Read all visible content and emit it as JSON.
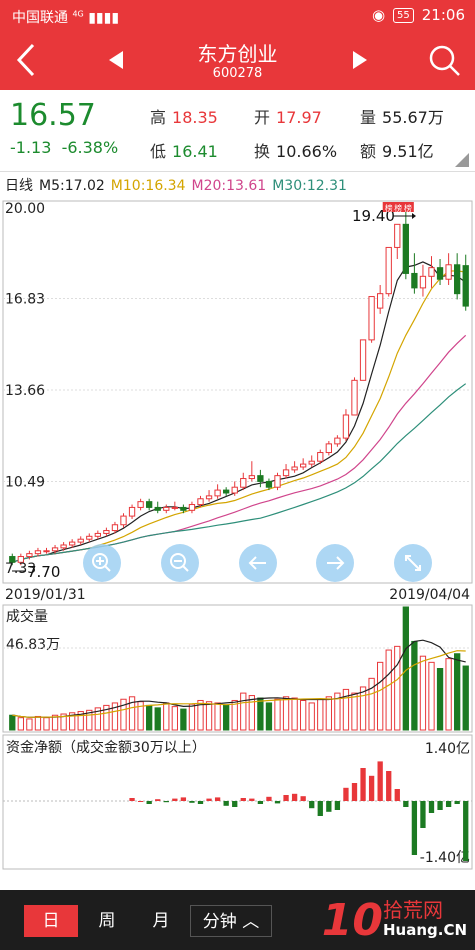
{
  "status": {
    "carrier": "中国联通",
    "net": "4G",
    "battery": "55",
    "time": "21:06"
  },
  "header": {
    "title": "东方创业",
    "code": "600278"
  },
  "quote": {
    "price": "16.57",
    "change": "-1.13",
    "change_pct": "-6.38%",
    "high_label": "高",
    "high": "18.35",
    "open_label": "开",
    "open": "17.97",
    "vol_label": "量",
    "vol": "55.67万",
    "low_label": "低",
    "low": "16.41",
    "turnover_label": "换",
    "turnover": "10.66%",
    "amount_label": "额",
    "amount": "9.51亿"
  },
  "ma": {
    "period": "日线",
    "m5": "M5:17.02",
    "m10": "M10:16.34",
    "m20": "M20:13.61",
    "m30": "M30:12.31"
  },
  "colors": {
    "up": "#e8373a",
    "down": "#1c7a22",
    "m5": "#222222",
    "m10": "#d4a500",
    "m20": "#d0458c",
    "m30": "#2e8f7a",
    "nav": "#e8373a"
  },
  "chart_data": {
    "type": "candlestick",
    "y_ticks": [
      "20.00",
      "16.83",
      "13.66",
      "10.49",
      "7.33"
    ],
    "ylim": [
      7.33,
      20.0
    ],
    "max_label": "19.40",
    "min_label": "7.70",
    "limit_up_badge": "榜",
    "date_start": "2019/01/31",
    "date_end": "2019/04/04",
    "volume_title": "成交量",
    "volume_tick": "46.83万",
    "capital_title": "资金净额（成交金额30万以上）",
    "capital_max": "1.40亿",
    "capital_min": "-1.40亿",
    "candles": [
      [
        7.9,
        7.7,
        8.0,
        7.6
      ],
      [
        7.7,
        7.9,
        8.0,
        7.6
      ],
      [
        7.9,
        8.0,
        8.1,
        7.8
      ],
      [
        8.0,
        8.1,
        8.2,
        7.9
      ],
      [
        8.1,
        8.1,
        8.2,
        8.0
      ],
      [
        8.1,
        8.2,
        8.3,
        8.0
      ],
      [
        8.2,
        8.3,
        8.4,
        8.1
      ],
      [
        8.3,
        8.4,
        8.5,
        8.2
      ],
      [
        8.4,
        8.5,
        8.6,
        8.3
      ],
      [
        8.5,
        8.6,
        8.7,
        8.4
      ],
      [
        8.6,
        8.7,
        8.8,
        8.5
      ],
      [
        8.7,
        8.8,
        8.9,
        8.6
      ],
      [
        8.8,
        9.0,
        9.1,
        8.7
      ],
      [
        9.0,
        9.3,
        9.4,
        8.9
      ],
      [
        9.3,
        9.6,
        9.7,
        9.2
      ],
      [
        9.6,
        9.8,
        9.9,
        9.5
      ],
      [
        9.8,
        9.6,
        9.9,
        9.5
      ],
      [
        9.6,
        9.5,
        9.8,
        9.4
      ],
      [
        9.5,
        9.6,
        9.7,
        9.4
      ],
      [
        9.6,
        9.6,
        9.8,
        9.5
      ],
      [
        9.6,
        9.5,
        9.7,
        9.4
      ],
      [
        9.5,
        9.7,
        9.8,
        9.4
      ],
      [
        9.7,
        9.9,
        10.0,
        9.6
      ],
      [
        9.9,
        10.0,
        10.2,
        9.8
      ],
      [
        10.0,
        10.2,
        10.4,
        9.9
      ],
      [
        10.2,
        10.1,
        10.3,
        10.0
      ],
      [
        10.1,
        10.3,
        10.5,
        10.0
      ],
      [
        10.3,
        10.6,
        10.8,
        10.2
      ],
      [
        10.6,
        10.7,
        11.2,
        10.5
      ],
      [
        10.7,
        10.5,
        10.9,
        10.3
      ],
      [
        10.5,
        10.3,
        10.6,
        10.2
      ],
      [
        10.3,
        10.7,
        10.8,
        10.2
      ],
      [
        10.7,
        10.9,
        11.1,
        10.6
      ],
      [
        10.9,
        11.0,
        11.2,
        10.8
      ],
      [
        11.0,
        11.1,
        11.3,
        10.9
      ],
      [
        11.1,
        11.2,
        11.4,
        11.0
      ],
      [
        11.2,
        11.5,
        11.6,
        11.1
      ],
      [
        11.5,
        11.8,
        11.9,
        11.4
      ],
      [
        11.8,
        12.0,
        12.1,
        11.7
      ],
      [
        12.0,
        12.8,
        13.0,
        11.9
      ],
      [
        12.8,
        14.0,
        14.1,
        12.8
      ],
      [
        14.0,
        15.4,
        15.4,
        14.0
      ],
      [
        15.4,
        16.9,
        16.9,
        15.3
      ],
      [
        16.5,
        17.0,
        17.3,
        16.3
      ],
      [
        17.0,
        18.6,
        18.6,
        16.9
      ],
      [
        18.6,
        19.4,
        19.4,
        18.2
      ],
      [
        19.4,
        17.7,
        19.9,
        17.5
      ],
      [
        17.7,
        17.2,
        18.4,
        17.0
      ],
      [
        17.2,
        17.6,
        18.0,
        16.9
      ],
      [
        17.6,
        17.9,
        18.3,
        17.2
      ],
      [
        17.9,
        17.5,
        18.2,
        17.3
      ],
      [
        17.5,
        18.0,
        18.4,
        17.3
      ],
      [
        18.0,
        17.0,
        18.4,
        16.8
      ],
      [
        17.97,
        16.57,
        18.35,
        16.41
      ]
    ],
    "volumes": [
      0.12,
      0.1,
      0.09,
      0.11,
      0.1,
      0.12,
      0.13,
      0.14,
      0.15,
      0.16,
      0.18,
      0.2,
      0.22,
      0.25,
      0.27,
      0.23,
      0.2,
      0.18,
      0.22,
      0.19,
      0.17,
      0.21,
      0.24,
      0.23,
      0.22,
      0.2,
      0.24,
      0.3,
      0.28,
      0.26,
      0.22,
      0.25,
      0.27,
      0.26,
      0.24,
      0.22,
      0.25,
      0.27,
      0.3,
      0.33,
      0.3,
      0.35,
      0.42,
      0.55,
      0.65,
      0.68,
      1.0,
      0.72,
      0.6,
      0.55,
      0.5,
      0.58,
      0.62,
      0.52
    ],
    "capital": [
      0.05,
      0.0,
      -0.05,
      0.03,
      -0.02,
      0.04,
      0.06,
      -0.03,
      -0.05,
      0.04,
      0.06,
      -0.08,
      -0.1,
      0.05,
      0.04,
      -0.05,
      0.07,
      -0.04,
      0.1,
      0.12,
      0.08,
      -0.12,
      -0.25,
      -0.18,
      -0.15,
      0.22,
      0.3,
      0.55,
      0.42,
      0.66,
      0.5,
      0.2,
      -0.1,
      -0.9,
      -0.45,
      -0.2,
      -0.15,
      -0.1,
      -0.05,
      -1.0
    ]
  },
  "nav_icons": [
    "zoom-in-icon",
    "zoom-out-icon",
    "arrow-left-icon",
    "arrow-right-icon",
    "expand-icon"
  ],
  "tabs": [
    "日",
    "周",
    "月",
    "分钟"
  ],
  "watermark": {
    "big": "10",
    "text": "拾荒网",
    "sub": "Huang.CN"
  }
}
